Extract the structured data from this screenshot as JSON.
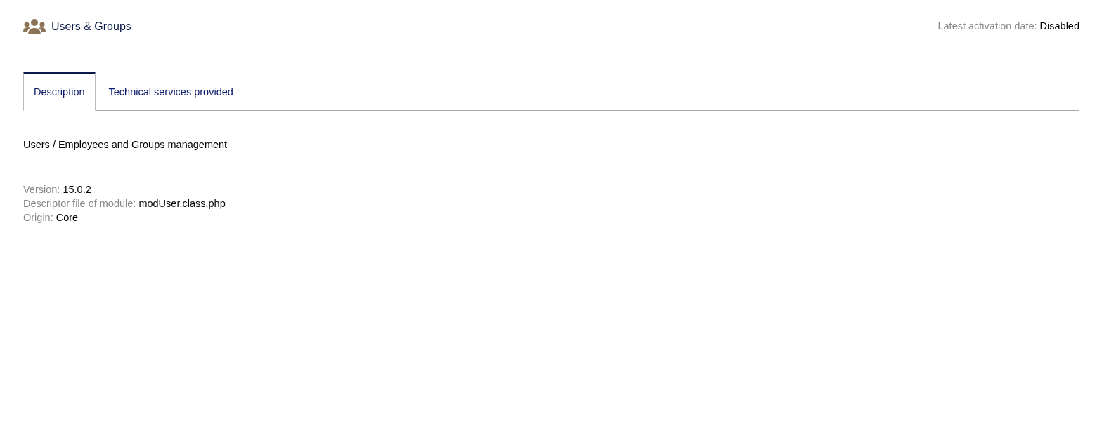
{
  "header": {
    "title": "Users & Groups",
    "activation": {
      "label": "Latest activation date:",
      "value": "Disabled"
    }
  },
  "tabs": [
    {
      "label": "Description",
      "selected": true
    },
    {
      "label": "Technical services provided",
      "selected": false
    }
  ],
  "description": "Users / Employees and Groups management",
  "properties": [
    {
      "label": "Version:",
      "value": "15.0.2"
    },
    {
      "label": "Descriptor file of module:",
      "value": "modUser.class.php"
    },
    {
      "label": "Origin:",
      "value": "Core"
    }
  ]
}
